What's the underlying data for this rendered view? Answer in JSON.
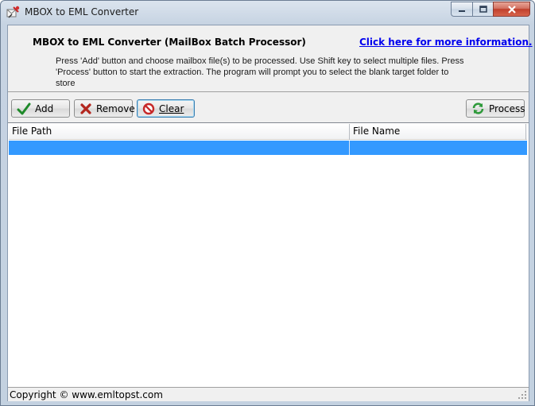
{
  "window": {
    "title": "MBOX to EML Converter"
  },
  "header": {
    "heading": "MBOX to EML Converter (MailBox Batch Processor)",
    "link_text": "Click here for more information.",
    "instructions": "Press 'Add' button and choose mailbox file(s) to be processed. Use Shift key to select multiple files. Press 'Process' button to start the extraction. The program will prompt you to select the blank target folder to store"
  },
  "toolbar": {
    "add_label": "Add",
    "remove_label": "Remove",
    "clear_label": "Clear",
    "process_label": "Process"
  },
  "table": {
    "columns": [
      "File Path",
      "File Name"
    ],
    "rows": [
      {
        "path": "",
        "name": "",
        "selected": true
      }
    ]
  },
  "status": {
    "text": "Copyright © www.emltopst.com"
  },
  "colors": {
    "selection": "#3399ff",
    "link": "#0000ee",
    "panel": "#f0f0f0"
  },
  "icons": {
    "app": "mail-tool-icon",
    "add": "checkmark-icon",
    "remove": "x-cross-icon",
    "clear": "prohibited-icon",
    "process": "refresh-icon"
  }
}
